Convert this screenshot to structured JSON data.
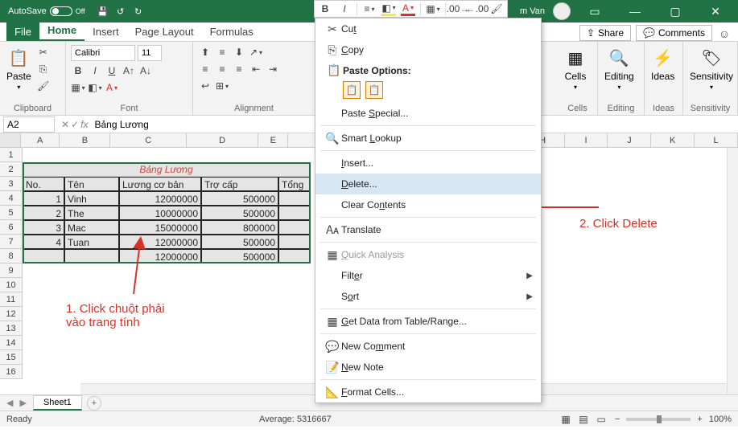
{
  "titlebar": {
    "autosave_label": "AutoSave",
    "autosave_state": "Off",
    "user_name": "m Van"
  },
  "tabs": {
    "file": "File",
    "home": "Home",
    "insert": "Insert",
    "page_layout": "Page Layout",
    "formulas": "Formulas",
    "share": "Share",
    "comments": "Comments"
  },
  "ribbon": {
    "paste": "Paste",
    "clipboard": "Clipboard",
    "font_group": "Font",
    "font_name": "Calibri",
    "font_size": "11",
    "alignment": "Alignment",
    "cells": "Cells",
    "editing": "Editing",
    "ideas": "Ideas",
    "sensitivity": "Sensitivity"
  },
  "formulabar": {
    "name": "A2",
    "fx": "fx",
    "value": "Bảng Lương"
  },
  "columns": [
    "A",
    "B",
    "C",
    "D",
    "E",
    "H",
    "I",
    "J",
    "K",
    "L"
  ],
  "rows": [
    "1",
    "2",
    "3",
    "4",
    "5",
    "6",
    "7",
    "8",
    "9",
    "10",
    "11",
    "12",
    "13",
    "14",
    "15",
    "16"
  ],
  "table": {
    "title": "Bảng Lương",
    "headers": [
      "No.",
      "Tên",
      "Lương cơ bản",
      "Trợ cấp",
      "Tổng"
    ],
    "rows": [
      {
        "no": "1",
        "ten": "Vinh",
        "luong": "12000000",
        "trocap": "500000"
      },
      {
        "no": "2",
        "ten": "The",
        "luong": "10000000",
        "trocap": "500000"
      },
      {
        "no": "3",
        "ten": "Mac",
        "luong": "15000000",
        "trocap": "800000"
      },
      {
        "no": "4",
        "ten": "Tuan",
        "luong": "12000000",
        "trocap": "500000"
      },
      {
        "no": "",
        "ten": "",
        "luong": "12000000",
        "trocap": "500000"
      }
    ]
  },
  "context_menu": {
    "cut": "Cut",
    "copy": "Copy",
    "paste_options": "Paste Options:",
    "paste_special": "Paste Special...",
    "smart_lookup": "Smart Lookup",
    "insert": "Insert...",
    "delete": "Delete...",
    "clear_contents": "Clear Contents",
    "translate": "Translate",
    "quick_analysis": "Quick Analysis",
    "filter": "Filter",
    "sort": "Sort",
    "get_data": "Get Data from Table/Range...",
    "new_comment": "New Comment",
    "new_note": "New Note",
    "format_cells": "Format Cells..."
  },
  "annotations": {
    "ann1_line1": "1. Click chuột phải",
    "ann1_line2": "vào trang tính",
    "ann2": "2. Click Delete"
  },
  "sheettab": {
    "sheet1": "Sheet1"
  },
  "statusbar": {
    "ready": "Ready",
    "average": "Average: 5316667",
    "zoom": "100%"
  }
}
